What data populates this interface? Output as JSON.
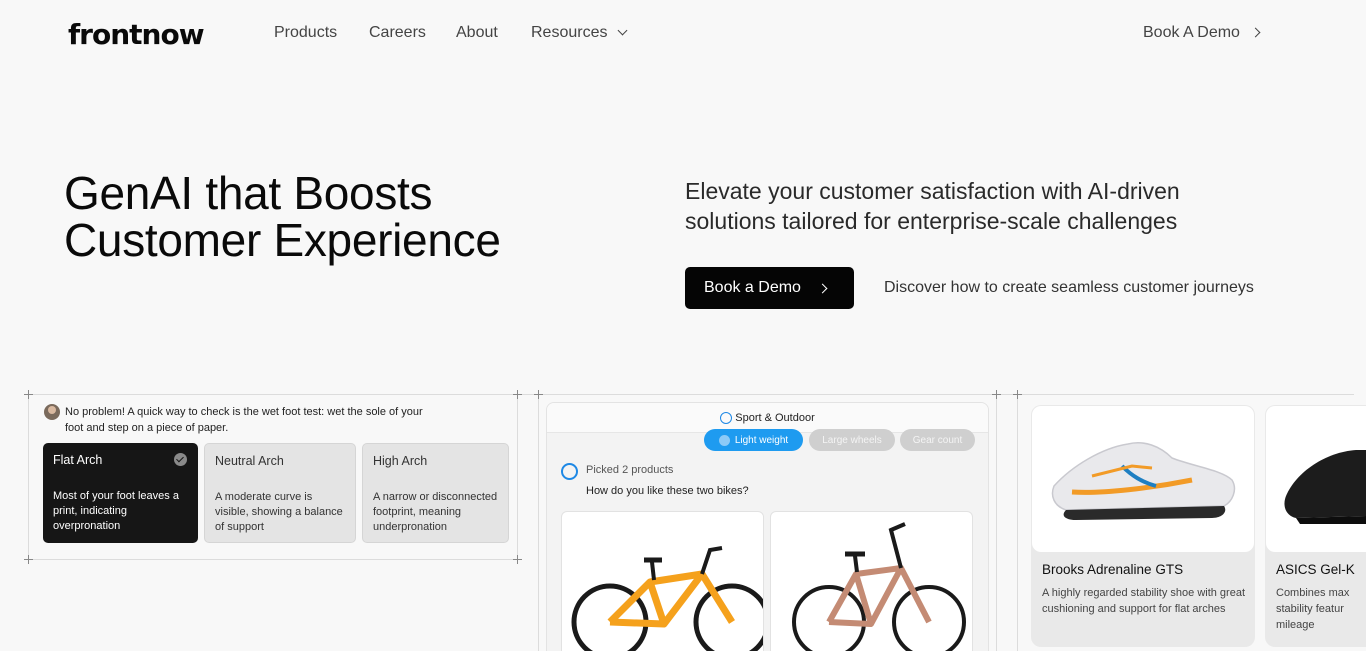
{
  "brand": {
    "logo": "frontnow"
  },
  "nav": {
    "items": [
      "Products",
      "Careers",
      "About",
      "Resources"
    ],
    "demo_link": "Book A Demo"
  },
  "hero": {
    "title_line1": "GenAI that Boosts",
    "title_line2": "Customer Experience",
    "subtitle": "Elevate your customer satisfaction with AI-driven solutions tailored for enterprise-scale challenges",
    "cta_label": "Book a Demo",
    "cta_note": "Discover how to create seamless customer journeys"
  },
  "panel1": {
    "message": "No problem! A quick way to check is the wet foot test: wet the sole of your foot and step on a piece of paper.",
    "options": [
      {
        "title": "Flat Arch",
        "desc": "Most of your foot leaves a print, indicating overpronation",
        "selected": true
      },
      {
        "title": "Neutral Arch",
        "desc": "A moderate curve is visible, showing a balance of support",
        "selected": false
      },
      {
        "title": "High Arch",
        "desc": "A narrow or disconnected footprint, meaning underpronation",
        "selected": false
      }
    ]
  },
  "panel2": {
    "category": "Sport & Outdoor",
    "chips": [
      {
        "label": "Light weight",
        "active": true
      },
      {
        "label": "Large wheels",
        "active": false
      },
      {
        "label": "Gear count",
        "active": false
      }
    ],
    "picked": "Picked 2 products",
    "question": "How do you like these two bikes?",
    "bike_colors": [
      "#f5a11c",
      "#c48b74"
    ]
  },
  "panel3": {
    "products": [
      {
        "name": "Brooks Adrenaline GTS",
        "desc": "A highly regarded stability shoe with great cushioning and support for flat arches"
      },
      {
        "name": "ASICS Gel-K",
        "desc": "Combines max stability featur mileage"
      }
    ]
  }
}
